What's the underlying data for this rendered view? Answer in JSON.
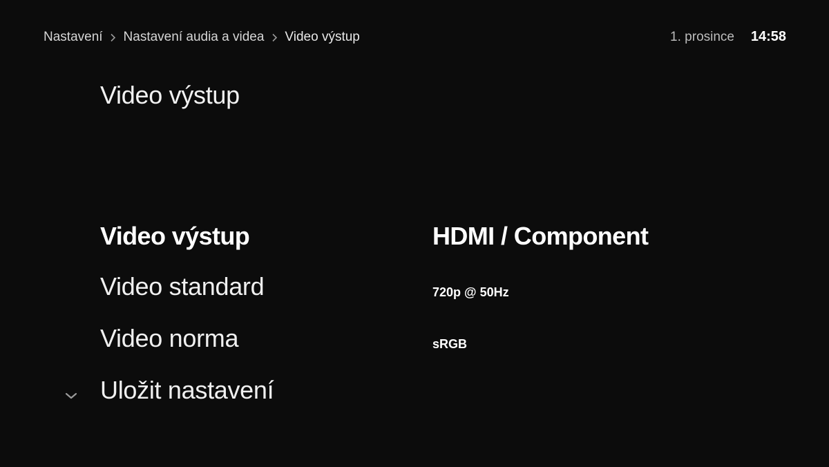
{
  "header": {
    "breadcrumb": [
      "Nastavení",
      "Nastavení audia a videa",
      "Video výstup"
    ],
    "breadcrumb_separator_icon": "chevron-right-icon",
    "date": "1. prosince",
    "time": "14:58"
  },
  "page_title": "Video výstup",
  "settings": [
    {
      "label": "Video výstup",
      "value": "HDMI / Component",
      "selected": true
    },
    {
      "label": "Video standard",
      "value": "720p @ 50Hz",
      "selected": false
    },
    {
      "label": "Video norma",
      "value": "sRGB",
      "selected": false
    },
    {
      "label": "Uložit nastavení",
      "selected": false
    }
  ],
  "scroll_indicator_icon": "chevron-down-icon",
  "colors": {
    "background": "#0c0c0c",
    "text": "#ffffff",
    "secondary_text": "#cfcfcf"
  }
}
